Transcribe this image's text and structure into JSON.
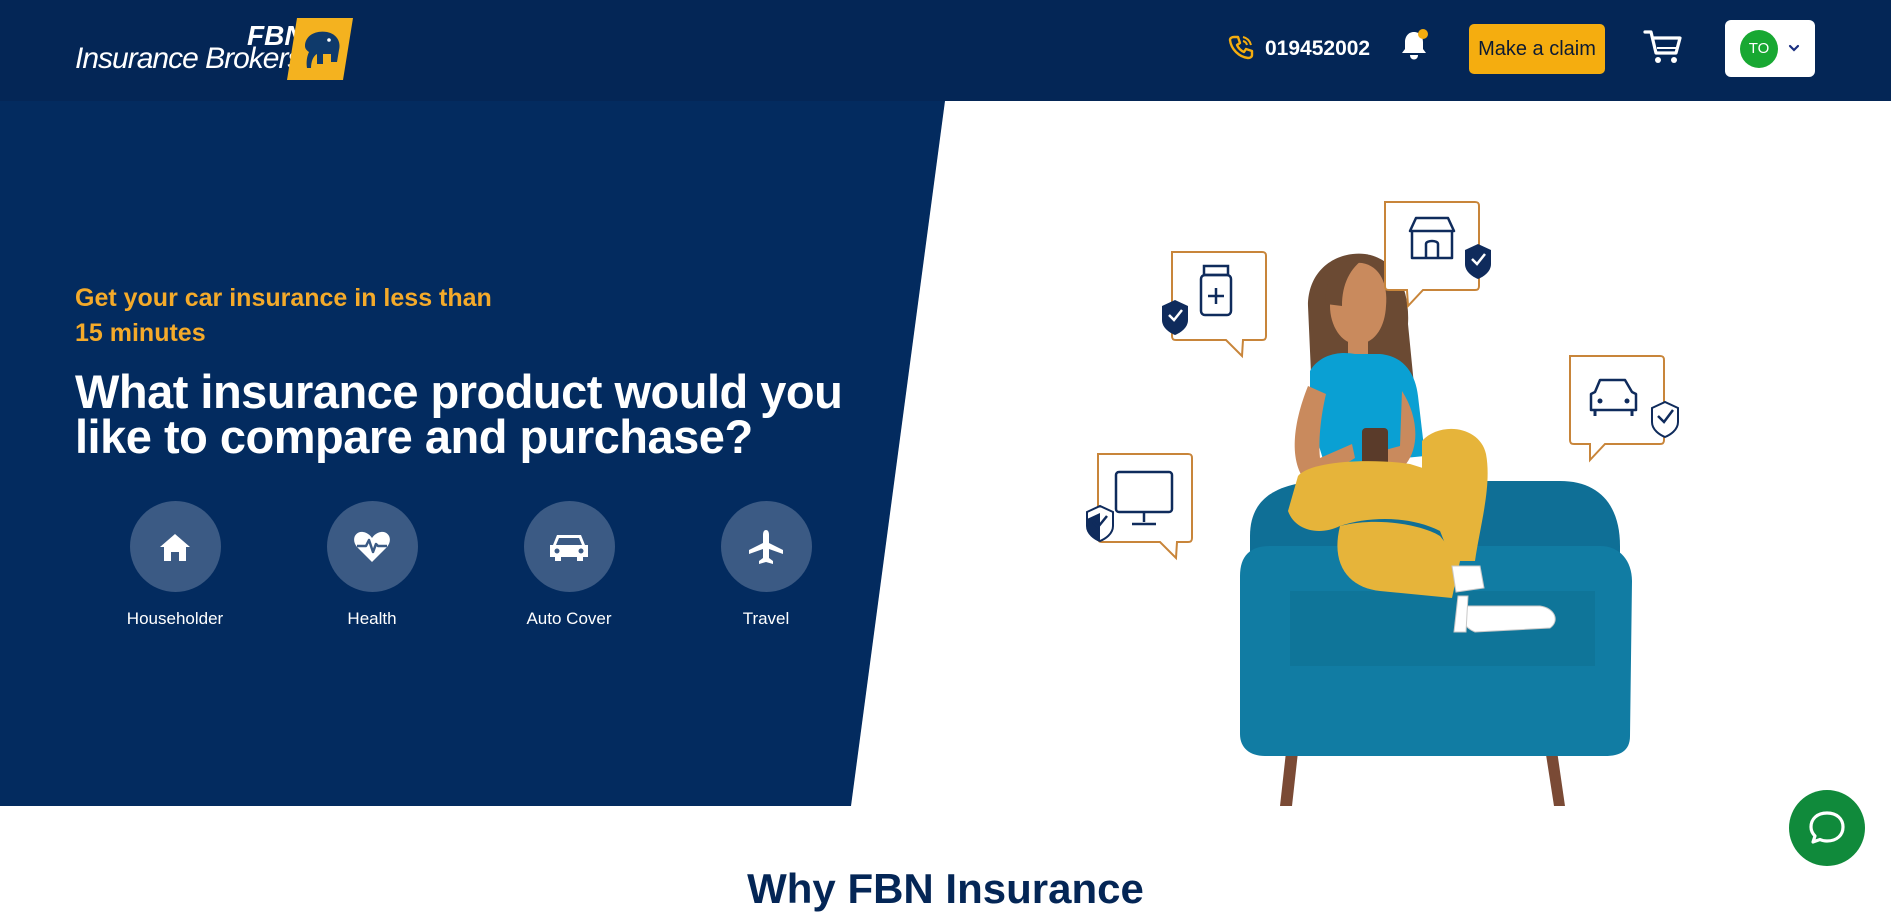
{
  "header": {
    "logo": {
      "top_text": "FBN",
      "brand_text": "Insurance Brokers"
    },
    "phone": {
      "icon": "phone-icon",
      "number": "019452002"
    },
    "notifications": {
      "icon": "bell-icon"
    },
    "claim_button": "Make a claim",
    "cart": {
      "icon": "cart-icon"
    },
    "account": {
      "initials": "TO",
      "icon": "chevron-down-icon"
    }
  },
  "hero": {
    "tagline": "Get your car insurance in less than 15 minutes",
    "headline": "What insurance product would you like to compare and purchase?",
    "products": [
      {
        "label": "Householder",
        "icon": "home-icon"
      },
      {
        "label": "Health",
        "icon": "heart-pulse-icon"
      },
      {
        "label": "Auto Cover",
        "icon": "car-icon"
      },
      {
        "label": "Travel",
        "icon": "airplane-icon"
      }
    ]
  },
  "section": {
    "title": "Why FBN Insurance"
  },
  "chat": {
    "icon": "chat-icon"
  },
  "colors": {
    "navy": "#042656",
    "hero_blue": "#032b5f",
    "accent": "#f5ad0f",
    "tagline": "#f4aa2a",
    "circle": "#3b5a84",
    "avatar": "#18a832",
    "chat": "#108a3b"
  }
}
